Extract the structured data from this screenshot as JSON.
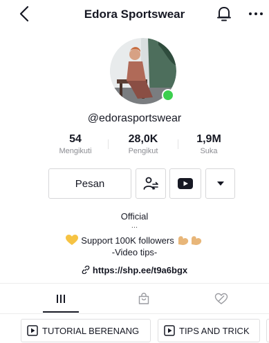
{
  "header": {
    "title": "Edora Sportswear",
    "back_icon": "chevron-left-icon",
    "bell_icon": "bell-icon",
    "more_icon": "more-dots-icon"
  },
  "profile": {
    "handle": "@edorasportswear",
    "online_color": "#3ccf4e",
    "stats": [
      {
        "value": "54",
        "label": "Mengikuti"
      },
      {
        "value": "28,0K",
        "label": "Pengikut"
      },
      {
        "value": "1,9M",
        "label": "Suka"
      }
    ]
  },
  "actions": {
    "message_label": "Pesan"
  },
  "bio": {
    "line1": "Official",
    "line2": "...",
    "line3": "Support 100K followers",
    "line4": "-Video tips-",
    "link": "https://shp.ee/t9a6bgx"
  },
  "tabs": [
    "videos-grid-icon",
    "shop-bag-icon",
    "liked-heart-icon"
  ],
  "playlists": [
    {
      "label": "TUTORIAL BERENANG"
    },
    {
      "label": "TIPS AND TRICK"
    }
  ]
}
